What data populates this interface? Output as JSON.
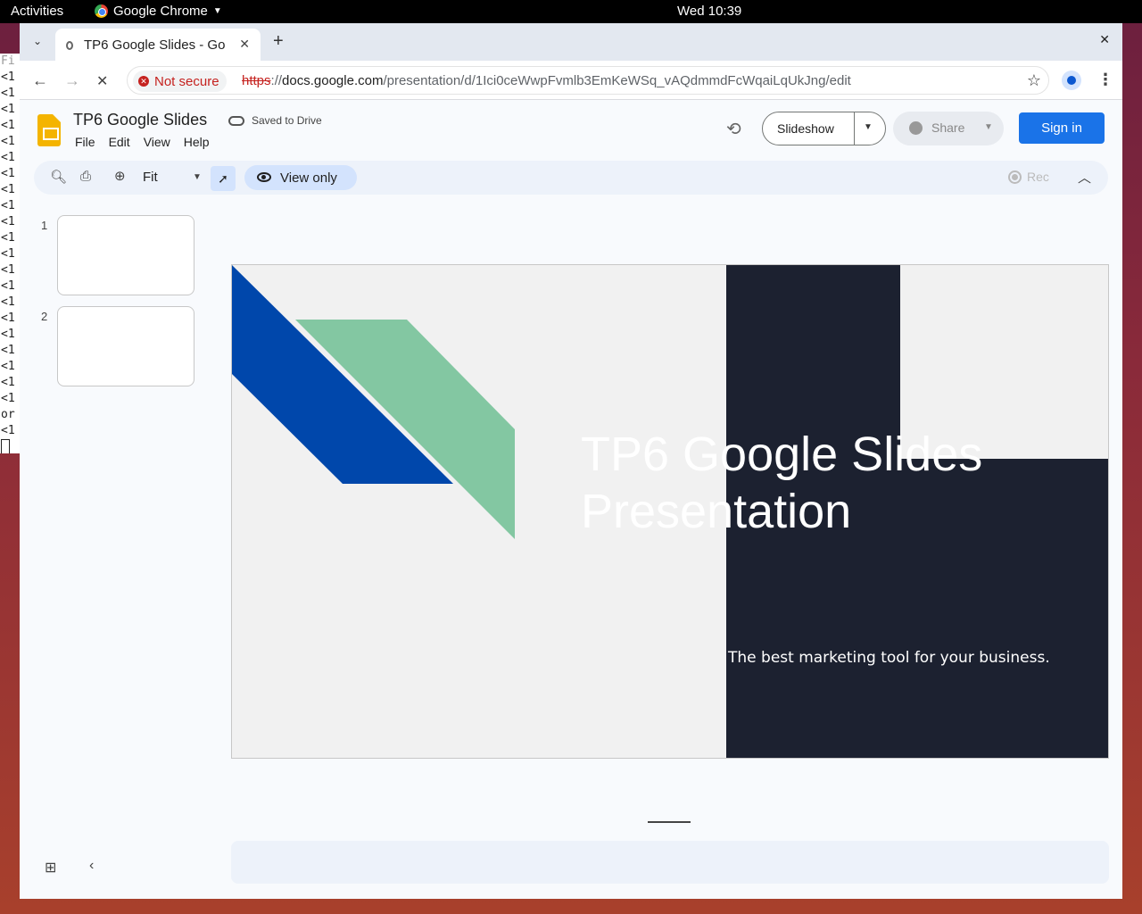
{
  "system_bar": {
    "activities": "Activities",
    "app_name": "Google Chrome",
    "clock": "Wed 10:39"
  },
  "terminal": {
    "lines": [
      "Fi",
      "<1",
      "<1",
      "<1",
      "<1",
      "<1",
      "<1",
      "<1",
      "<1",
      "<1",
      "<1",
      "<1",
      "<1",
      "<1",
      "<1",
      "<1",
      "<1",
      "<1",
      "<1",
      "<1",
      "<1",
      "<1",
      "or",
      "<1"
    ]
  },
  "browser": {
    "tab_title": "TP6 Google Slides - Go",
    "url_scheme": "https",
    "url_host": "docs.google.com",
    "url_path": "/presentation/d/1Ici0ceWwpFvmlb3EmKeWSq_vAQdmmdFcWqaiLqUkJng/edit",
    "security_label": "Not secure",
    "icons": [
      "tab-list-icon",
      "new-tab-icon",
      "close-icon",
      "back-icon",
      "forward-icon",
      "stop-icon",
      "star-icon",
      "profile-icon",
      "more-icon"
    ]
  },
  "slides_header": {
    "doc_title": "TP6 Google Slides",
    "save_status": "Saved to Drive",
    "menu": [
      "File",
      "Edit",
      "View",
      "Help"
    ],
    "slideshow_label": "Slideshow",
    "share_label": "Share",
    "sign_in_label": "Sign in"
  },
  "slides_toolbar": {
    "zoom_value": "Fit",
    "mode_label": "View only",
    "rec_label": "Rec"
  },
  "filmstrip": {
    "slides": [
      {
        "number": "1"
      },
      {
        "number": "2"
      }
    ]
  },
  "slide": {
    "title_line1": "TP6 Google Slides",
    "title_line2": "Presentation",
    "subtitle": "The best marketing tool for your business.",
    "colors": {
      "background": "#f1f1f1",
      "dark_panel": "#1c2130",
      "blue_band": "#0047ab",
      "green_band": "#83c7a2"
    }
  },
  "colors": {
    "accent": "#1a73e8",
    "not_secure": "#c5221f",
    "slides_logo": "#f4b400"
  }
}
